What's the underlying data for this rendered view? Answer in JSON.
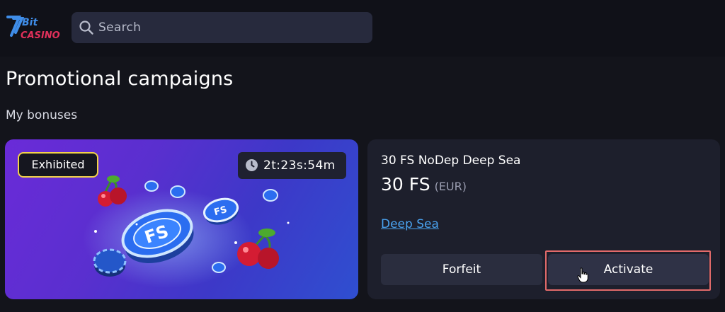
{
  "header": {
    "logo_text": "7Bit CASINO",
    "search": {
      "placeholder": "Search",
      "value": ""
    }
  },
  "page": {
    "title": "Promotional campaigns",
    "section_label": "My bonuses"
  },
  "bonus": {
    "status_badge": "Exhibited",
    "timer": "2t:23s:54m",
    "art_label": "FS",
    "name": "30 FS NoDep Deep Sea",
    "amount": "30 FS",
    "currency": "(EUR)",
    "game_link": "Deep Sea",
    "forfeit_label": "Forfeit",
    "activate_label": "Activate"
  },
  "icons": {
    "search": "search-icon",
    "clock": "clock-icon",
    "cursor": "hand-cursor-icon"
  },
  "colors": {
    "background": "#13141b",
    "card": "#1d1f2c",
    "badge_border": "#f2d24a",
    "link": "#4aa3f0",
    "highlight": "#e26a6a"
  }
}
